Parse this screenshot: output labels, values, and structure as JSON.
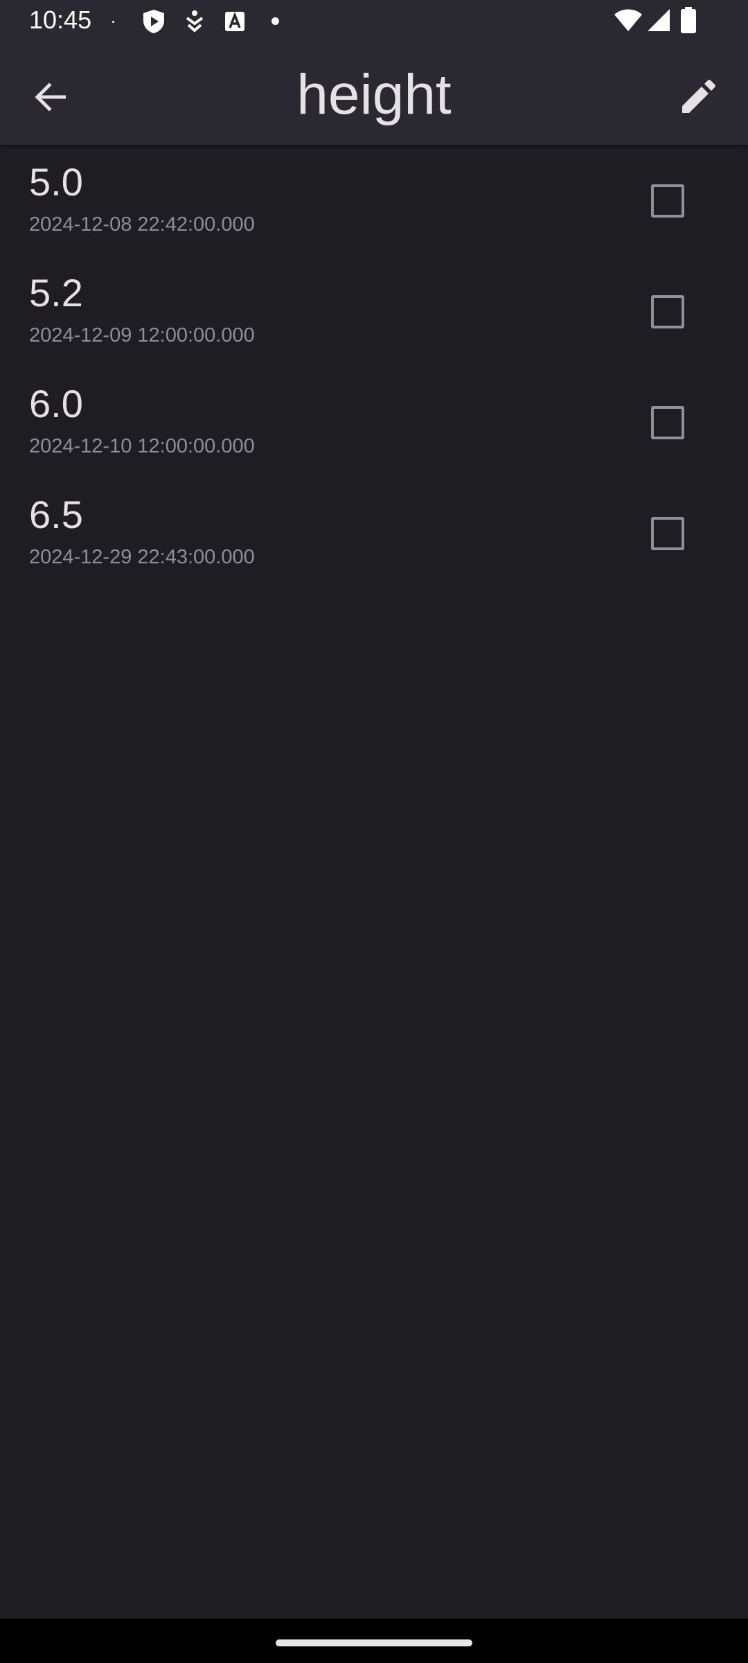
{
  "status_bar": {
    "time": "10:45",
    "icons": [
      "dot-icon",
      "shield-play-icon",
      "accessibility-icon",
      "text-a-icon",
      "dot-icon",
      "wifi-icon",
      "signal-icon",
      "battery-icon"
    ]
  },
  "app_bar": {
    "title": "height",
    "back_icon": "arrow-back-icon",
    "edit_icon": "edit-pencil-icon"
  },
  "entries": [
    {
      "value": "5.0",
      "timestamp": "2024-12-08 22:42:00.000",
      "checked": false
    },
    {
      "value": "5.2",
      "timestamp": "2024-12-09 12:00:00.000",
      "checked": false
    },
    {
      "value": "6.0",
      "timestamp": "2024-12-10 12:00:00.000",
      "checked": false
    },
    {
      "value": "6.5",
      "timestamp": "2024-12-29 22:43:00.000",
      "checked": false
    }
  ],
  "colors": {
    "background": "#1e1d22",
    "app_bar": "#2a2931",
    "primary_text": "#e6e1e5",
    "secondary_text": "#908d96",
    "checkbox_border": "#938f99"
  }
}
